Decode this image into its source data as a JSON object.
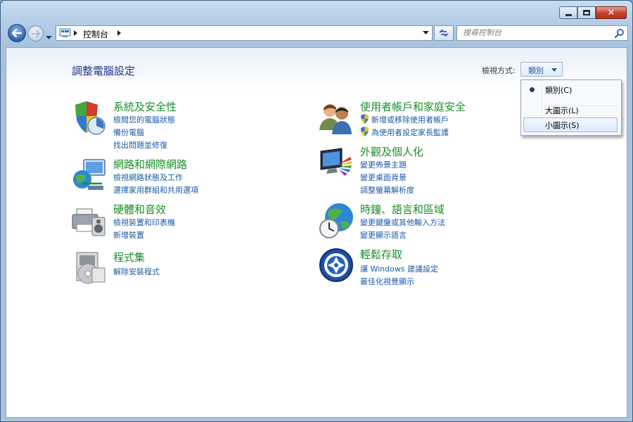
{
  "window": {
    "caption_buttons": [
      "minimize",
      "maximize",
      "close"
    ],
    "close_glyph": "✕"
  },
  "navigation": {
    "address": {
      "breadcrumb": [
        "控制台"
      ]
    },
    "search": {
      "placeholder": "搜尋控制台"
    }
  },
  "main": {
    "title": "調整電腦設定",
    "view_by_label": "檢視方式:",
    "view_by_value": "類別",
    "categories": [
      {
        "id": "system-security",
        "title": "系統及安全性",
        "icon": "shield-computer-icon",
        "links": [
          "檢閱您的電腦狀態",
          "備份電腦",
          "找出問題並修復"
        ]
      },
      {
        "id": "network-internet",
        "title": "網路和網際網路",
        "icon": "network-globe-icon",
        "links": [
          "檢視網路狀態及工作",
          "選擇家用群組和共用選項"
        ]
      },
      {
        "id": "hardware-sound",
        "title": "硬體和音效",
        "icon": "printer-speaker-icon",
        "links": [
          "檢視裝置和印表機",
          "新增裝置"
        ]
      },
      {
        "id": "programs",
        "title": "程式集",
        "icon": "programs-disc-icon",
        "links": [
          "解除安裝程式"
        ]
      },
      {
        "id": "user-accounts",
        "title": "使用者帳戶和家庭安全",
        "icon": "users-icon",
        "links": [
          "新增或移除使用者帳戶",
          "為使用者設定家長監護"
        ]
      },
      {
        "id": "appearance",
        "title": "外觀及個人化",
        "icon": "monitor-palette-icon",
        "links": [
          "變更佈景主題",
          "變更桌面背景",
          "調整螢幕解析度"
        ]
      },
      {
        "id": "clock-language",
        "title": "時鐘、語言和區域",
        "icon": "clock-globe-icon",
        "links": [
          "變更鍵盤或其他輸入方法",
          "變更顯示語言"
        ]
      },
      {
        "id": "ease-of-access",
        "title": "輕鬆存取",
        "icon": "ease-of-access-icon",
        "links": [
          "讓 Windows 建議設定",
          "最佳化視覺顯示"
        ]
      }
    ]
  },
  "view_menu": {
    "items": [
      {
        "label": "類別(C)",
        "selected": true
      },
      {
        "label": "大圖示(L)",
        "selected": false
      },
      {
        "label": "小圖示(S)",
        "selected": false,
        "hovered": true
      }
    ]
  },
  "colors": {
    "category_title": "#1a8d2a",
    "link": "#1e5aa6",
    "page_title": "#1e3287"
  }
}
